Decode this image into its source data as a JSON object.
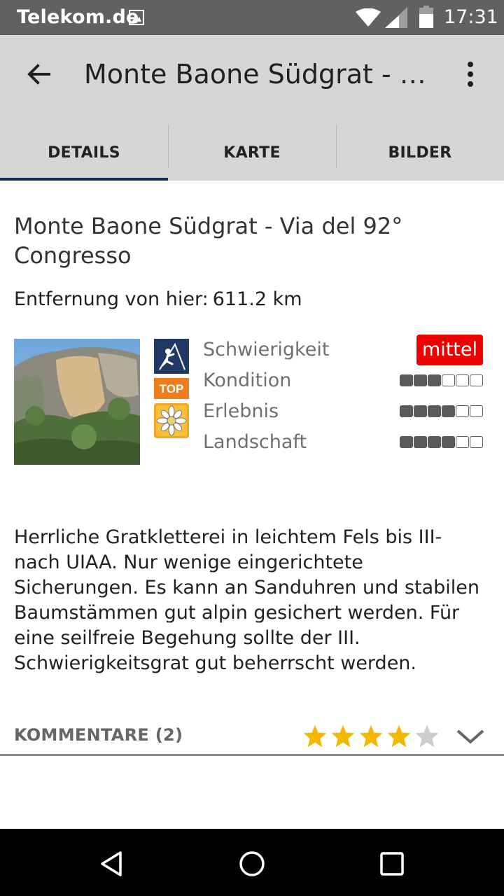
{
  "status_bar": {
    "carrier": "Telekom.de",
    "time": "17:31",
    "icons": [
      "image-icon",
      "wifi-icon",
      "signal-icon",
      "battery-icon"
    ]
  },
  "toolbar": {
    "title": "Monte Baone Südgrat - Vi...",
    "back_icon": "arrow-back-icon",
    "menu_icon": "more-vert-icon"
  },
  "tabs": [
    {
      "label": "DETAILS",
      "active": true
    },
    {
      "label": "KARTE",
      "active": false
    },
    {
      "label": "BILDER",
      "active": false
    }
  ],
  "route": {
    "title": "Monte Baone Südgrat - Via del 92° Congresso",
    "distance_label": "Entfernung von hier:",
    "distance_value": "611.2 km",
    "badges": [
      "climbing-icon",
      "top-badge",
      "edelweiss-icon"
    ],
    "top_badge_text": "TOP",
    "ratings": {
      "difficulty_label": "Schwierigkeit",
      "difficulty_value": "mittel",
      "condition_label": "Kondition",
      "condition_level": 3,
      "experience_label": "Erlebnis",
      "experience_level": 4,
      "landscape_label": "Landschaft",
      "landscape_level": 4,
      "max_level": 6
    },
    "description": "Herrliche Gratkletterei in leichtem Fels bis III- nach UIAA. Nur wenige eingerichtete Sicherungen. Es kann an Sanduhren und stabilen Baumstämmen gut alpin gesichert werden. Für eine seilfreie Begehung sollte der III. Schwierigkeitsgrat gut beherrscht werden."
  },
  "comments": {
    "label": "KOMMENTARE (2)",
    "stars": 4,
    "max_stars": 5,
    "expand_icon": "chevron-down-icon"
  },
  "nav_bar": {
    "icons": [
      "nav-back-icon",
      "nav-home-icon",
      "nav-recents-icon"
    ]
  },
  "colors": {
    "status_bar": "#616161",
    "toolbar": "#d6d6d6",
    "tab_indicator": "#1a2e5a",
    "difficulty_badge": "#ee0000",
    "star": "#f5b800",
    "star_empty": "#cccccc"
  }
}
